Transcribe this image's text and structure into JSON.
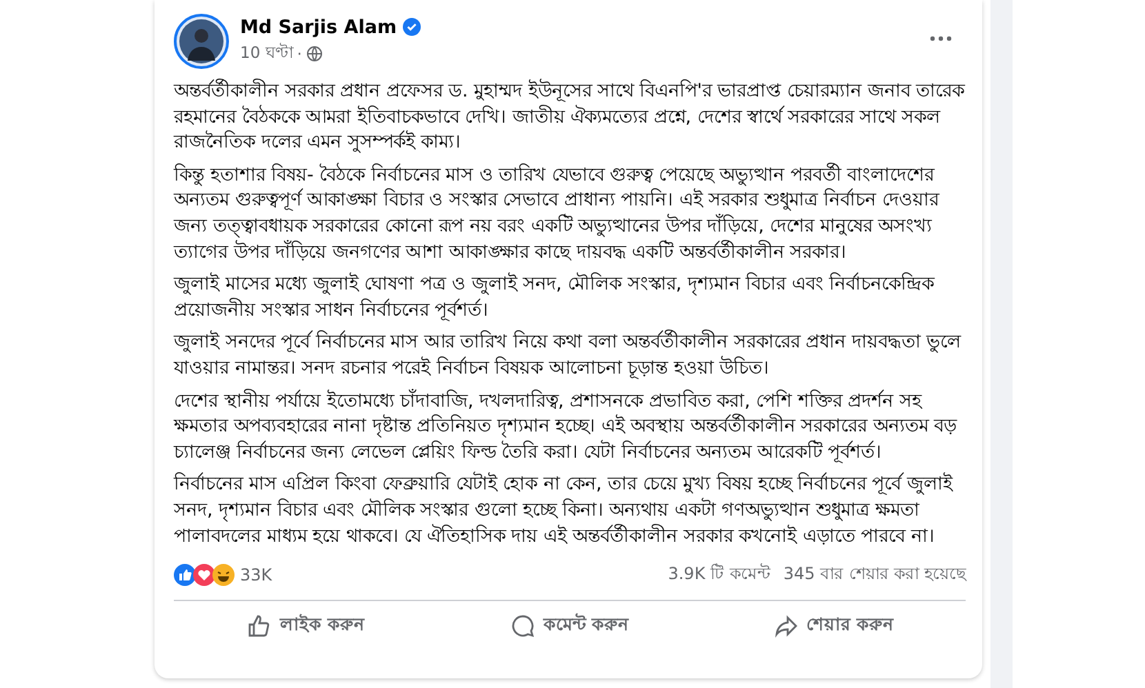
{
  "post": {
    "author": "Md Sarjis Alam",
    "verified": true,
    "time": "10 ঘণ্টা",
    "separator": "·",
    "public": true,
    "paragraphs": [
      "অন্তর্বর্তীকালীন সরকার প্রধান প্রফেসর ড. মুহাম্মদ ইউনূসের সাথে বিএনপি'র ভারপ্রাপ্ত চেয়ারম্যান জনাব তারেক রহমানের বৈঠককে আমরা ইতিবাচকভাবে দেখি। জাতীয় ঐক্যমত্যের প্রশ্নে, দেশের স্বার্থে সরকারের সাথে সকল রাজনৈতিক দলের এমন সুসম্পর্কই কাম্য।",
      "কিন্তু হতাশার বিষয়- বৈঠকে নির্বাচনের মাস ও তারিখ যেভাবে গুরুত্ব পেয়েছে অভ্যুত্থান পরবর্তী বাংলাদেশের অন্যতম গুরুত্বপূর্ণ আকাঙ্ক্ষা বিচার ও সংস্কার সেভাবে প্রাধান্য পায়নি। এই সরকার শুধুমাত্র নির্বাচন দেওয়ার জন্য তত্ত্বাবধায়ক সরকারের কোনো রূপ নয় বরং একটি অভ্যুত্থানের উপর দাঁড়িয়ে, দেশের মানুষের অসংখ্য ত্যাগের উপর দাঁড়িয়ে জনগণের আশা আকাঙ্ক্ষার কাছে দায়বদ্ধ একটি অন্তর্বর্তীকালীন সরকার।",
      "জুলাই মাসের মধ্যে জুলাই ঘোষণা পত্র ও জুলাই সনদ, মৌলিক সংস্কার, দৃশ্যমান বিচার এবং নির্বাচনকেন্দ্রিক প্রয়োজনীয় সংস্কার সাধন নির্বাচনের পূর্বশর্ত।",
      "জুলাই সনদের পূর্বে নির্বাচনের মাস আর তারিখ নিয়ে কথা বলা অন্তর্বর্তীকালীন সরকারের প্রধান দায়বদ্ধতা ভুলে যাওয়ার নামান্তর। সনদ রচনার পরেই নির্বাচন বিষয়ক আলোচনা চূড়ান্ত হওয়া উচিত।",
      "দেশের স্থানীয় পর্যায়ে ইতোমধ্যে চাঁদাবাজি, দখলদারিত্ব, প্রশাসনকে প্রভাবিত করা, পেশি শক্তির প্রদর্শন সহ ক্ষমতার অপব্যবহারের নানা দৃষ্টান্ত প্রতিনিয়ত দৃশ্যমান হচ্ছে। এই অবস্থায় অন্তর্বর্তীকালীন সরকারের অন্যতম বড় চ্যালেঞ্জ নির্বাচনের জন্য লেভেল প্লেয়িং ফিল্ড তৈরি করা। যেটা নির্বাচনের অন্যতম আরেকটি পূর্বশর্ত।",
      "নির্বাচনের মাস এপ্রিল কিংবা ফেব্রুয়ারি যেটাই হোক না কেন, তার চেয়ে মুখ্য বিষয় হচ্ছে নির্বাচনের পূর্বে জুলাই সনদ, দৃশ্যমান বিচার এবং মৌলিক সংস্কার গুলো হচ্ছে কিনা। অন্যথায় একটা গণঅভ্যুত্থান শুধুমাত্র ক্ষমতা পালাবদলের মাধ্যম হয়ে থাকবে। যে ঐতিহাসিক দায় এই অন্তর্বর্তীকালীন সরকার কখনোই এড়াতে পারবে না।"
    ],
    "reactions": [
      {
        "kind": "like"
      },
      {
        "kind": "love"
      },
      {
        "kind": "haha"
      }
    ],
    "reaction_count": "33K",
    "comments": "3.9K টি কমেন্ট",
    "shares": "345 বার শেয়ার করা হয়েছে",
    "actions": [
      {
        "kind": "like",
        "label": "লাইক করুন"
      },
      {
        "kind": "comment",
        "label": "কমেন্ট করুন"
      },
      {
        "kind": "share",
        "label": "শেয়ার করুন"
      }
    ]
  }
}
